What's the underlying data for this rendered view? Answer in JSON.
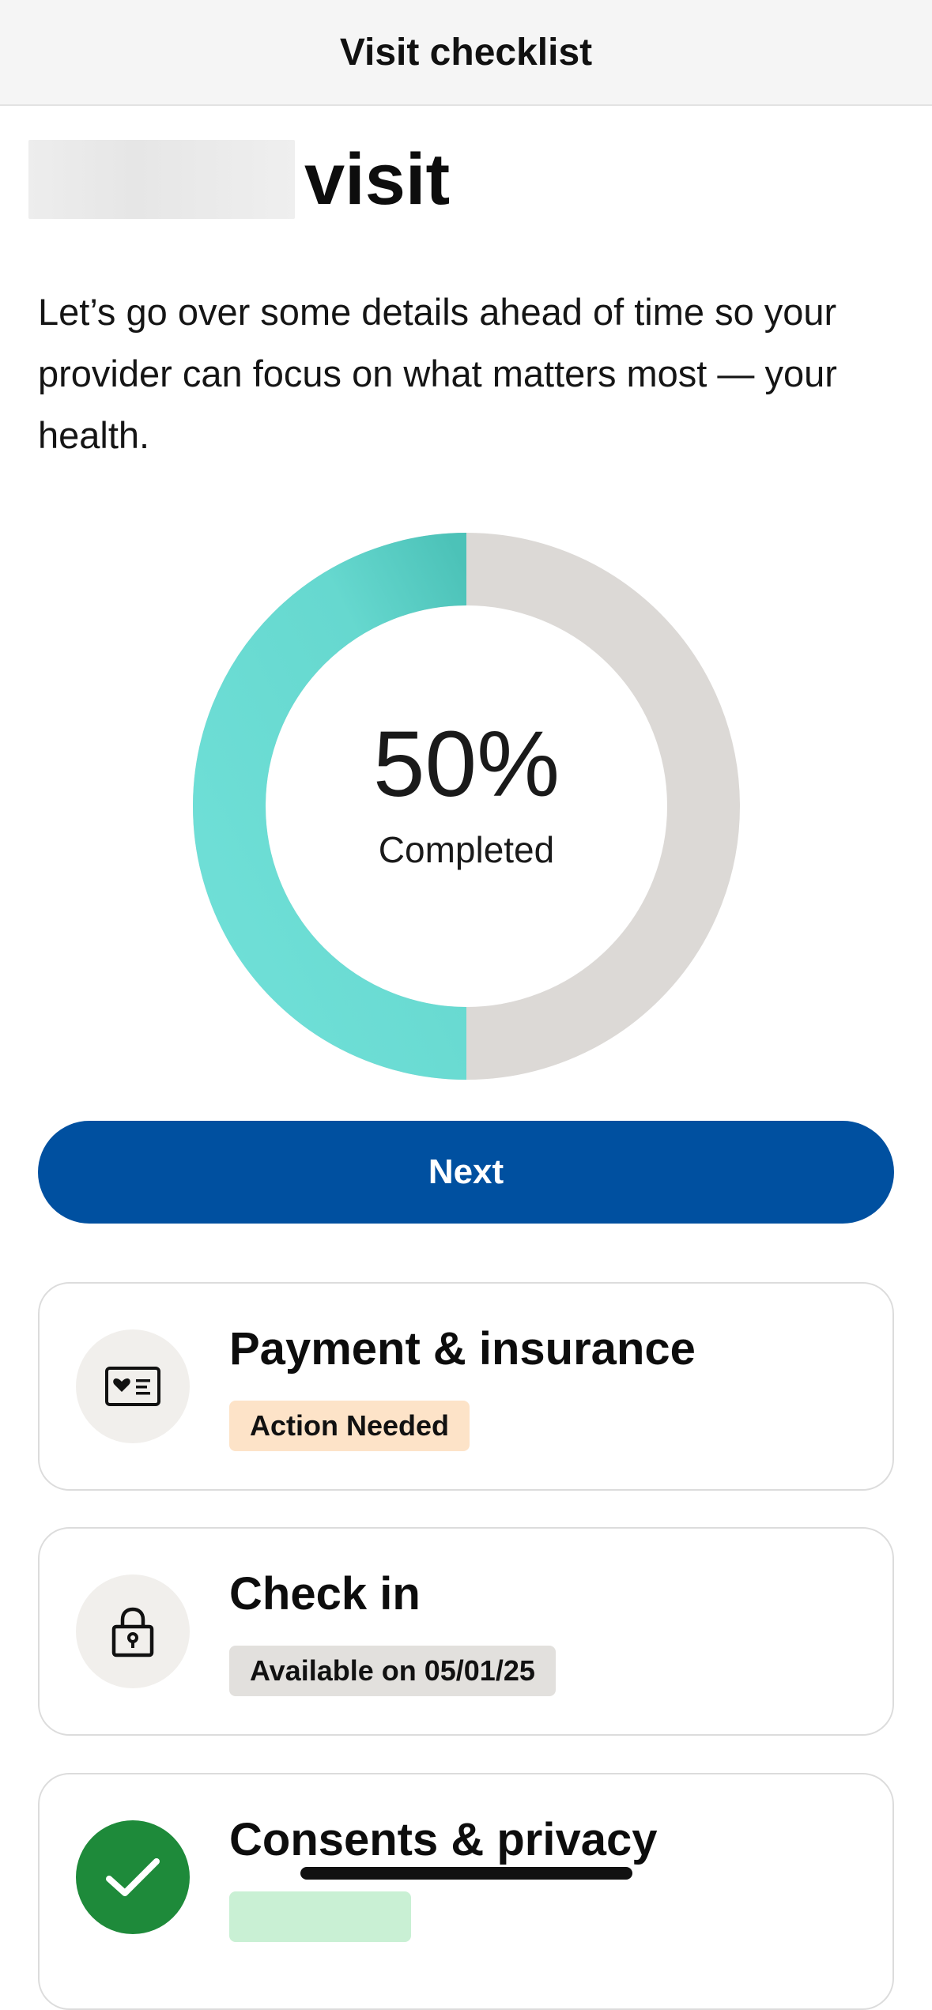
{
  "header": {
    "title": "Visit checklist"
  },
  "page": {
    "title_suffix": "visit",
    "intro": "Let’s go over some details ahead of time so your provider can focus on what matters most — your health."
  },
  "progress": {
    "percent_value": 0.5,
    "percent_label": "50%",
    "label": "Completed",
    "colors": {
      "filled": "#6ad9d0",
      "remaining": "#dcd9d6"
    }
  },
  "actions": {
    "next_label": "Next"
  },
  "tasks": [
    {
      "title": "Payment & insurance",
      "status": "Action Needed",
      "icon": "insurance-card-icon"
    },
    {
      "title": "Check in",
      "status": "Available on 05/01/25",
      "icon": "lock-icon"
    },
    {
      "title": "Consents & privacy",
      "status": "",
      "icon": "checkmark-icon"
    }
  ],
  "colors": {
    "primary": "#0050a0",
    "action_badge": "#fde3c8",
    "done": "#1e8a3a"
  }
}
